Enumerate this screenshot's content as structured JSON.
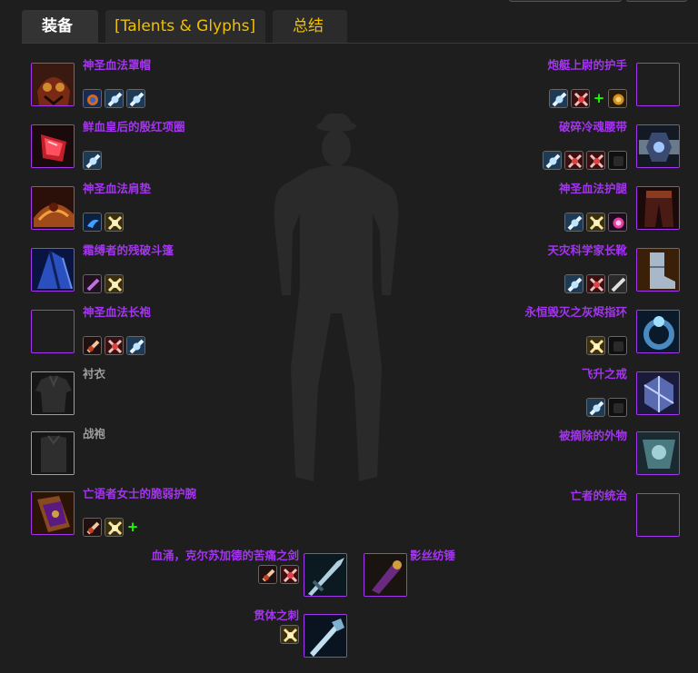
{
  "tabs": [
    {
      "label": "装备",
      "active": true
    },
    {
      "label": "[Talents & Glyphs]",
      "active": false
    },
    {
      "label": "总结",
      "active": false
    }
  ],
  "colors": {
    "epic": "#a335ee",
    "common": "#9d9d9d",
    "tab_inactive": "#f0c000",
    "enchant_plus": "#1eff00",
    "background": "#1e1e1f"
  },
  "left_items": [
    {
      "slot": "head",
      "name": "神圣血法罩帽",
      "quality": "epic",
      "icon": "helm-icon",
      "gems": [
        "blue-gem-icon",
        "white-gem-icon",
        "white-gem-icon"
      ],
      "plus": false
    },
    {
      "slot": "neck",
      "name": "鲜血皇后的殷红项圈",
      "quality": "epic",
      "icon": "ruby-necklace-icon",
      "gems": [
        "white-gem-icon"
      ],
      "plus": false
    },
    {
      "slot": "shoulder",
      "name": "神圣血法肩垫",
      "quality": "epic",
      "icon": "shoulder-icon",
      "gems": [
        "blue-swirl-gem-icon",
        "yellow-gem-icon"
      ],
      "plus": false
    },
    {
      "slot": "back",
      "name": "霜缚者的残破斗篷",
      "quality": "epic",
      "icon": "cloak-icon",
      "gems": [
        "purple-gem-icon",
        "yellow-gem-icon"
      ],
      "plus": false
    },
    {
      "slot": "chest",
      "name": "神圣血法长袍",
      "quality": "epic",
      "icon": "empty-slot-icon",
      "gems": [
        "orange-gem-icon",
        "red-gem-icon",
        "white-gem-icon"
      ],
      "plus": false
    },
    {
      "slot": "shirt",
      "name": "衬衣",
      "quality": "common",
      "icon": "shirt-icon",
      "gems": [],
      "plus": false
    },
    {
      "slot": "tabard",
      "name": "战袍",
      "quality": "common",
      "icon": "tabard-icon",
      "gems": [],
      "plus": false
    },
    {
      "slot": "wrist",
      "name": "亡语者女士的脆弱护腕",
      "quality": "epic",
      "icon": "bracer-icon",
      "gems": [
        "orange-gem-icon",
        "yellow-gem-icon"
      ],
      "plus": true
    }
  ],
  "right_items": [
    {
      "slot": "hands",
      "name": "炮艇上尉的护手",
      "quality": "epic",
      "icon": "empty-slot-icon",
      "gems": [
        "white-gem-icon",
        "red-gem-icon"
      ],
      "plus": true,
      "extra_gem": "gold-rune-icon"
    },
    {
      "slot": "waist",
      "name": "破碎冷魂腰带",
      "quality": "epic",
      "icon": "belt-icon",
      "gems": [
        "white-gem-icon",
        "red-gem-icon",
        "red-gem-icon",
        "dark-socket-icon"
      ],
      "plus": false
    },
    {
      "slot": "legs",
      "name": "神圣血法护腿",
      "quality": "epic",
      "icon": "legs-icon",
      "gems": [
        "white-gem-icon",
        "yellow-gem-icon",
        "purple-orb-icon"
      ],
      "plus": false
    },
    {
      "slot": "feet",
      "name": "天灾科学家长靴",
      "quality": "epic",
      "icon": "boots-icon",
      "gems": [
        "white-gem-icon",
        "red-gem-icon",
        "white-gem-icon"
      ],
      "plus": false
    },
    {
      "slot": "finger1",
      "name": "永恒毁灭之灰烬指环",
      "quality": "epic",
      "icon": "ring-icon",
      "gems": [
        "yellow-gem-icon",
        "dark-socket-icon"
      ],
      "plus": false
    },
    {
      "slot": "finger2",
      "name": "飞升之戒",
      "quality": "epic",
      "icon": "ring2-icon",
      "gems": [
        "white-gem-icon",
        "dark-socket-icon"
      ],
      "plus": false
    },
    {
      "slot": "trinket1",
      "name": "被摘除的外物",
      "quality": "epic",
      "icon": "trinket-icon",
      "gems": [],
      "plus": false
    },
    {
      "slot": "trinket2",
      "name": "亡者的统治",
      "quality": "epic",
      "icon": "empty-slot-icon",
      "gems": [],
      "plus": false
    }
  ],
  "bottom_items": [
    {
      "slot": "mainhand",
      "name": "血涌，克尔苏加德的苦痛之剑",
      "quality": "epic",
      "icon": "sword-icon",
      "gems": [
        "orange-gem-icon",
        "red-gem-icon"
      ]
    },
    {
      "slot": "offhand",
      "name": "影丝纺锤",
      "quality": "epic",
      "icon": "offhand-icon",
      "gems": []
    },
    {
      "slot": "ranged",
      "name": "贯体之刺",
      "quality": "epic",
      "icon": "wand-icon",
      "gems": [
        "yellow-gem-icon"
      ]
    }
  ]
}
